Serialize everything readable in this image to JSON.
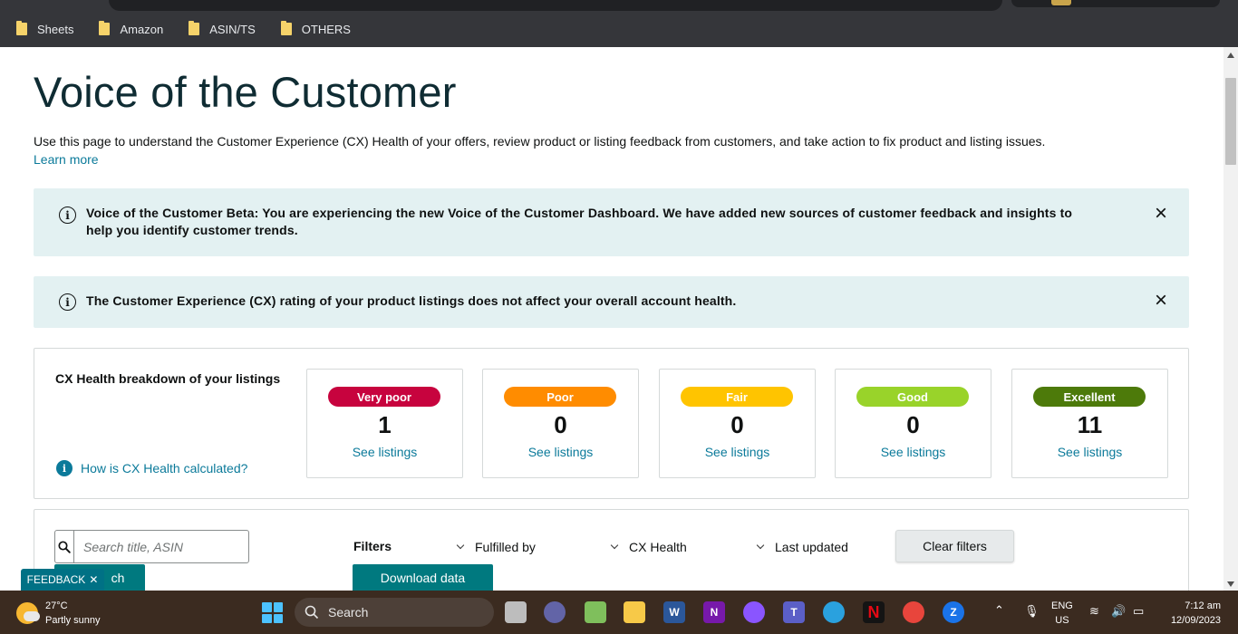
{
  "browser": {
    "bookmarks": [
      "Sheets",
      "Amazon",
      "ASIN/TS",
      "OTHERS"
    ]
  },
  "page": {
    "title": "Voice of the Customer",
    "description": "Use this page to understand the Customer Experience (CX) Health of your offers, review product or listing feedback from customers, and take action to fix product and listing issues.",
    "learn_more": "Learn more"
  },
  "alerts": [
    {
      "line1": "Voice of the Customer Beta: You are experiencing the new Voice of the Customer Dashboard. We have added new sources of customer feedback and insights to",
      "line2": "help you identify customer trends."
    },
    {
      "line1": "The Customer Experience (CX) rating of your product listings does not affect your overall account health."
    }
  ],
  "cx_health": {
    "heading": "CX Health breakdown of your listings",
    "help_link": "How is CX Health calculated?",
    "cards": [
      {
        "label": "Very poor",
        "count": "1",
        "link": "See listings",
        "color": "#c7033e"
      },
      {
        "label": "Poor",
        "count": "0",
        "link": "See listings",
        "color": "#ff8c00"
      },
      {
        "label": "Fair",
        "count": "0",
        "link": "See listings",
        "color": "#ffc400"
      },
      {
        "label": "Good",
        "count": "0",
        "link": "See listings",
        "color": "#99d32a"
      },
      {
        "label": "Excellent",
        "count": "11",
        "link": "See listings",
        "color": "#4d7a0a"
      }
    ]
  },
  "filters": {
    "search_placeholder": "Search title, ASIN",
    "search_button": "ch",
    "label": "Filters",
    "fulfilled_by": "Fulfilled by",
    "cx_health": "CX Health",
    "last_updated": "Last updated",
    "clear": "Clear filters",
    "download": "Download data"
  },
  "feedback": {
    "label": "FEEDBACK",
    "close": "✕"
  },
  "taskbar": {
    "temperature": "27°C",
    "weather": "Partly sunny",
    "search": "Search",
    "lang_top": "ENG",
    "lang_bottom": "US",
    "time": "7:12 am",
    "date": "12/09/2023"
  },
  "colors": {
    "teal": "#00797f",
    "link": "#0b7a9a",
    "alert_bg": "#e3f1f2"
  }
}
